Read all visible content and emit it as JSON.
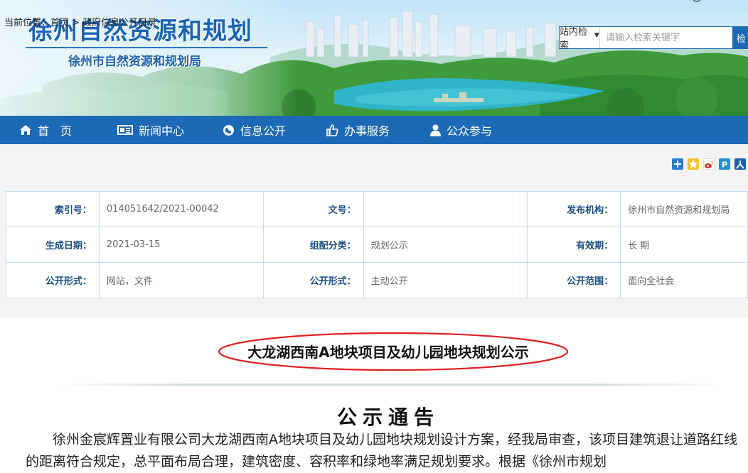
{
  "header": {
    "site_title": "徐州自然资源和规划",
    "site_subtitle": "徐州市自然资源和规划局"
  },
  "search": {
    "scope_label": "站内检索",
    "placeholder": "请输入检索关键字",
    "button_label": "检"
  },
  "nav": {
    "items": [
      {
        "label": "首　页",
        "icon": "home-icon"
      },
      {
        "label": "新闻中心",
        "icon": "newspaper-icon"
      },
      {
        "label": "信息公开",
        "icon": "globe-icon"
      },
      {
        "label": "办事服务",
        "icon": "thumbs-up-icon"
      },
      {
        "label": "公众参与",
        "icon": "user-icon"
      }
    ]
  },
  "breadcrumb": {
    "text": "当前位置：首页 > 政府信息公开目录"
  },
  "share": {
    "icons": [
      "add-share-icon",
      "qzone-icon",
      "weibo-icon",
      "pengyou-icon",
      "renren-icon"
    ],
    "colors": [
      "#2b7bd1",
      "#e8a21a",
      "#d6332a",
      "#2a8fcf",
      "#1f5fa8"
    ]
  },
  "meta": {
    "rows": [
      [
        {
          "label": "索引号：",
          "value": "014051642/2021-00042"
        },
        {
          "label": "文号：",
          "value": ""
        },
        {
          "label": "发布机构：",
          "value": "徐州市自然资源和规划局"
        }
      ],
      [
        {
          "label": "生成日期：",
          "value": "2021-03-15"
        },
        {
          "label": "组配分类：",
          "value": "规划公示"
        },
        {
          "label": "有效期：",
          "value": "长 期"
        }
      ],
      [
        {
          "label": "公开形式：",
          "value": "网站，文件"
        },
        {
          "label": "公开形式：",
          "value": "主动公开"
        },
        {
          "label": "公开范围：",
          "value": "面向全社会"
        }
      ]
    ]
  },
  "article": {
    "title": "大龙湖西南A地块项目及幼儿园地块规划公示",
    "notice_heading": "公示通告",
    "body": "徐州金宸辉置业有限公司大龙湖西南A地块项目及幼儿园地块规划设计方案，经我局审查，该项目建筑退让道路红线的距离符合规定，总平面布局合理，建筑密度、容积率和绿地率满足规划要求。根据《徐州市规划"
  },
  "colors": {
    "brand_blue": "#1c69b5",
    "title_blue": "#1a64b0",
    "annotation_red": "#e02020"
  }
}
